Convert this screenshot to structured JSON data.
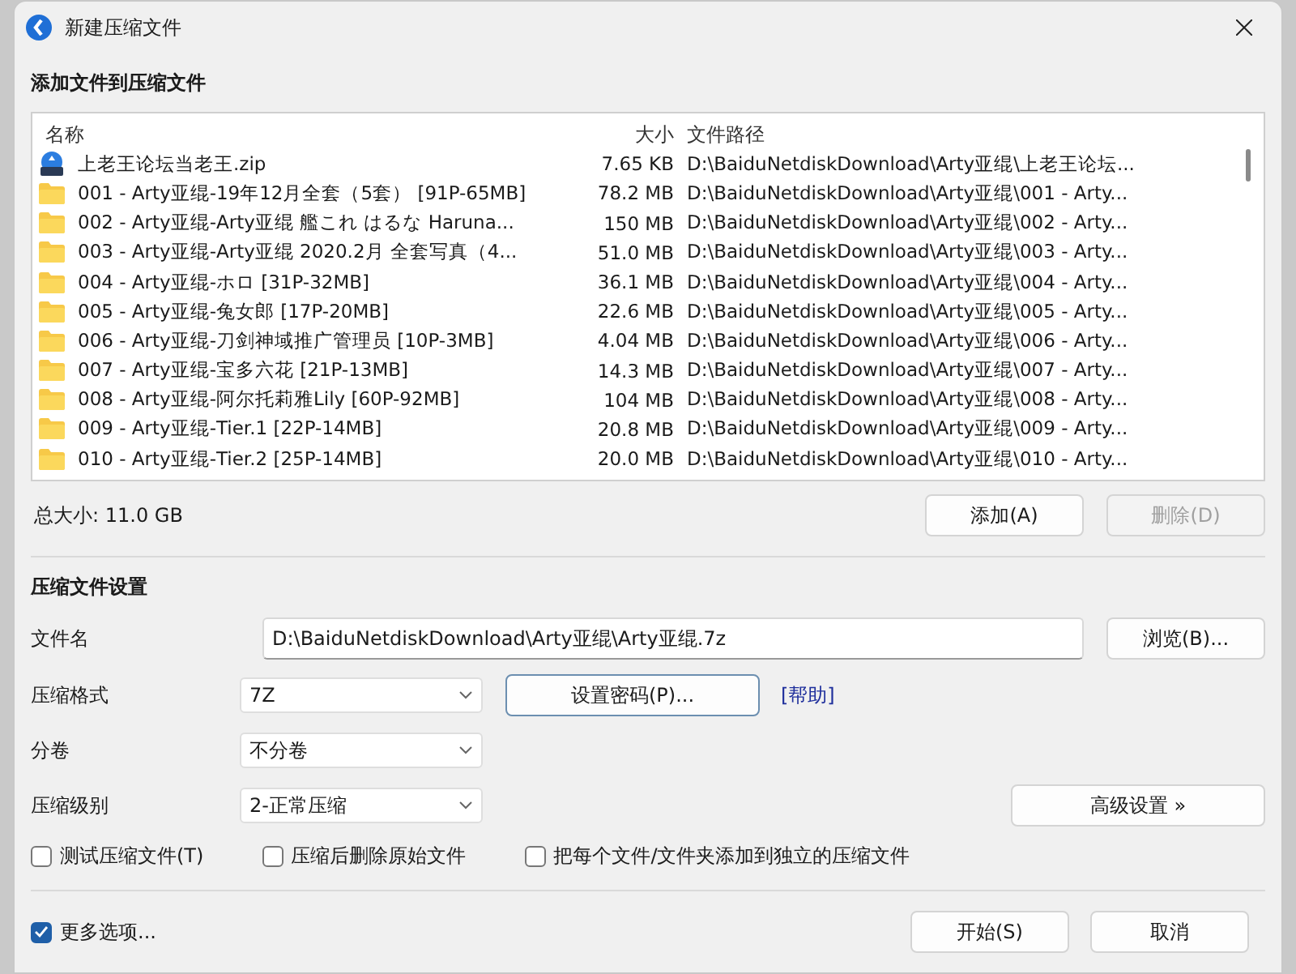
{
  "window": {
    "title": "新建压缩文件"
  },
  "files_section": {
    "heading": "添加文件到压缩文件",
    "columns": [
      "名称",
      "大小",
      "文件路径"
    ],
    "rows": [
      {
        "kind": "zip",
        "name": "上老王论坛当老王.zip",
        "size": "7.65 KB",
        "path": "D:\\BaiduNetdiskDownload\\Arty亚绲\\上老王论坛..."
      },
      {
        "kind": "folder",
        "name": "001 - Arty亚绲-19年12月全套（5套） [91P-65MB]",
        "size": "78.2 MB",
        "path": "D:\\BaiduNetdiskDownload\\Arty亚绲\\001 - Arty..."
      },
      {
        "kind": "folder",
        "name": "002 - Arty亚绲-Arty亚绲  艦これ はるな Haruna...",
        "size": "150 MB",
        "path": "D:\\BaiduNetdiskDownload\\Arty亚绲\\002 - Arty..."
      },
      {
        "kind": "folder",
        "name": "003 - Arty亚绲-Arty亚绲  2020.2月 全套写真（4...",
        "size": "51.0 MB",
        "path": "D:\\BaiduNetdiskDownload\\Arty亚绲\\003 - Arty..."
      },
      {
        "kind": "folder",
        "name": "004 - Arty亚绲-ホロ [31P-32MB]",
        "size": "36.1 MB",
        "path": "D:\\BaiduNetdiskDownload\\Arty亚绲\\004 - Arty..."
      },
      {
        "kind": "folder",
        "name": "005 - Arty亚绲-兔女郎 [17P-20MB]",
        "size": "22.6 MB",
        "path": "D:\\BaiduNetdiskDownload\\Arty亚绲\\005 - Arty..."
      },
      {
        "kind": "folder",
        "name": "006 - Arty亚绲-刀剑神域推广管理员 [10P-3MB]",
        "size": "4.04 MB",
        "path": "D:\\BaiduNetdiskDownload\\Arty亚绲\\006 - Arty..."
      },
      {
        "kind": "folder",
        "name": "007 - Arty亚绲-宝多六花 [21P-13MB]",
        "size": "14.3 MB",
        "path": "D:\\BaiduNetdiskDownload\\Arty亚绲\\007 - Arty..."
      },
      {
        "kind": "folder",
        "name": "008 - Arty亚绲-阿尔托莉雅Lily [60P-92MB]",
        "size": "104 MB",
        "path": "D:\\BaiduNetdiskDownload\\Arty亚绲\\008 - Arty..."
      },
      {
        "kind": "folder",
        "name": "009 - Arty亚绲-Tier.1 [22P-14MB]",
        "size": "20.8 MB",
        "path": "D:\\BaiduNetdiskDownload\\Arty亚绲\\009 - Arty..."
      },
      {
        "kind": "folder",
        "name": "010 - Arty亚绲-Tier.2 [25P-14MB]",
        "size": "20.0 MB",
        "path": "D:\\BaiduNetdiskDownload\\Arty亚绲\\010 - Arty..."
      }
    ],
    "total_size": "总大小: 11.0 GB",
    "add_button": {
      "label": "添加(A)",
      "disabled": false
    },
    "remove_button": {
      "label": "删除(D)",
      "disabled": true
    }
  },
  "settings": {
    "heading": "压缩文件设置",
    "filename": {
      "label": "文件名",
      "value": "D:\\BaiduNetdiskDownload\\Arty亚绲\\Arty亚绲.7z",
      "browse": "浏览(B)..."
    },
    "format": {
      "label": "压缩格式",
      "value": "7Z",
      "password_button": "设置密码(P)...",
      "help_link": "[帮助]"
    },
    "split": {
      "label": "分卷",
      "value": "不分卷"
    },
    "level": {
      "label": "压缩级别",
      "value": "2-正常压缩",
      "advanced_button": "高级设置 »"
    },
    "options": [
      {
        "label": "测试压缩文件(T)",
        "checked": false
      },
      {
        "label": "压缩后删除原始文件",
        "checked": false
      },
      {
        "label": "把每个文件/文件夹添加到独立的压缩文件",
        "checked": false
      }
    ]
  },
  "footer": {
    "more_options": {
      "label": "更多选项...",
      "checked": true
    },
    "start_button": "开始(S)",
    "cancel_button": "取消"
  }
}
